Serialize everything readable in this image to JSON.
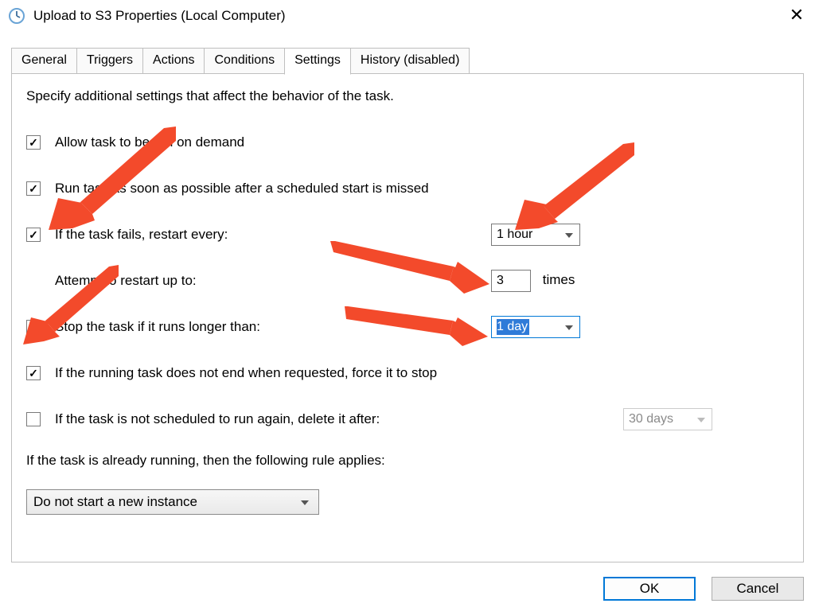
{
  "window": {
    "title": "Upload to S3 Properties (Local Computer)"
  },
  "tabs": {
    "items": [
      {
        "label": "General"
      },
      {
        "label": "Triggers"
      },
      {
        "label": "Actions"
      },
      {
        "label": "Conditions"
      },
      {
        "label": "Settings"
      },
      {
        "label": "History (disabled)"
      }
    ],
    "active_index": 4
  },
  "settings_panel": {
    "intro": "Specify additional settings that affect the behavior of the task.",
    "allow_on_demand": {
      "checked": true,
      "label": "Allow task to be run on demand"
    },
    "run_after_missed": {
      "checked": true,
      "label": "Run task as soon as possible after a scheduled start is missed"
    },
    "restart_on_fail": {
      "checked": true,
      "label": "If the task fails, restart every:",
      "interval": "1 hour",
      "attempt_label": "Attempt to restart up to:",
      "attempt_count": "3",
      "attempt_suffix": "times"
    },
    "stop_if_long": {
      "checked": true,
      "label": "Stop the task if it runs longer than:",
      "value": "1 day"
    },
    "force_stop": {
      "checked": true,
      "label": "If the running task does not end when requested, force it to stop"
    },
    "delete_if_unscheduled": {
      "checked": false,
      "label": "If the task is not scheduled to run again, delete it after:",
      "value": "30 days"
    },
    "running_rule": {
      "label": "If the task is already running, then the following rule applies:",
      "value": "Do not start a new instance"
    }
  },
  "buttons": {
    "ok": "OK",
    "cancel": "Cancel"
  }
}
